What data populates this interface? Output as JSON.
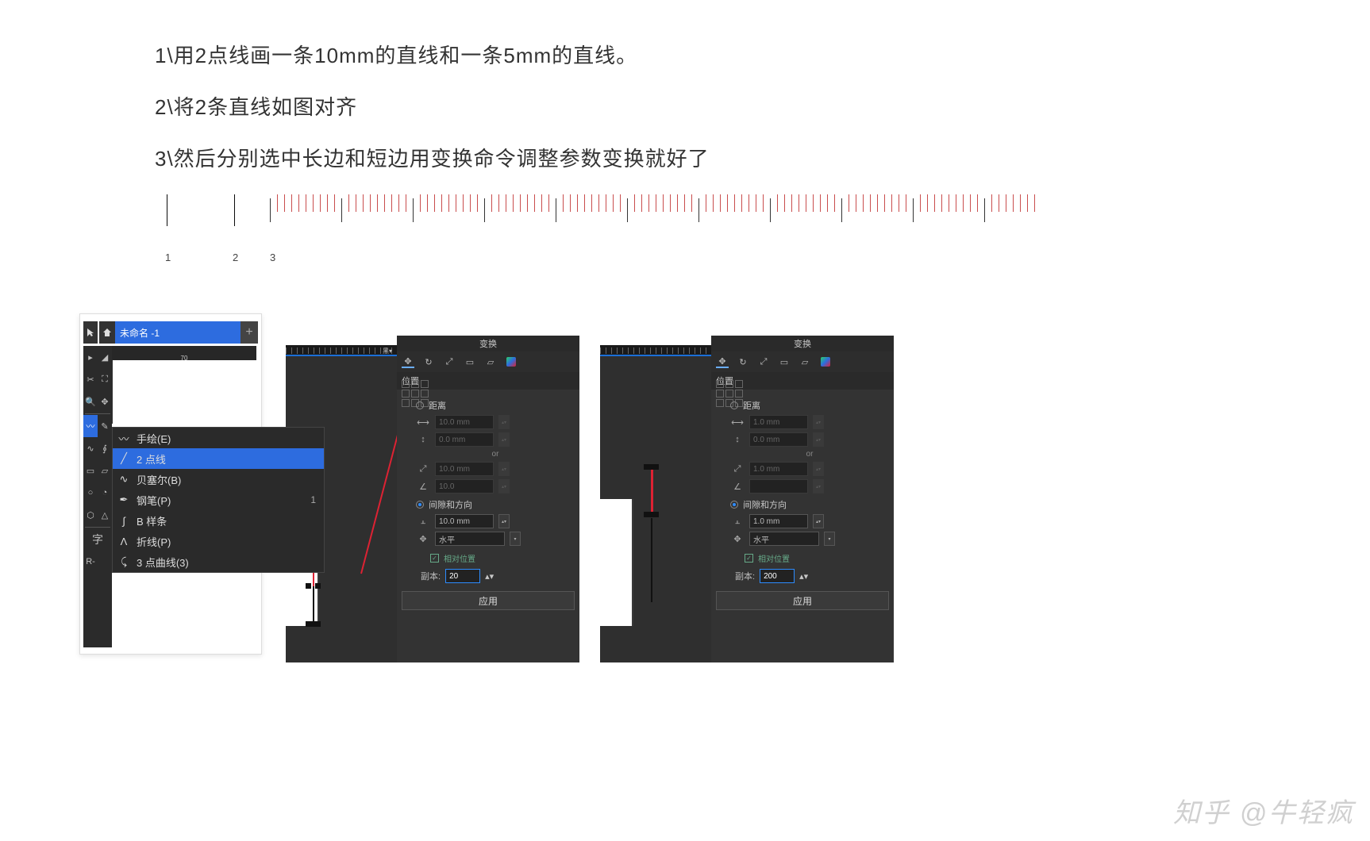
{
  "instructions": {
    "step1": "1\\用2点线画一条10mm的直线和一条5mm的直线。",
    "step2": "2\\将2条直线如图对齐",
    "step3": "3\\然后分别选中长边和短边用变换命令调整参数变换就好了"
  },
  "ruler_numbers": {
    "n1": "1",
    "n2": "2",
    "n3": "3"
  },
  "panel1": {
    "doc_tab": "未命名 -1",
    "add_tab": "+",
    "ruler_mark": "70",
    "text_tool": "字",
    "flyout": {
      "freehand": "手绘(E)",
      "two_point": "2 点线",
      "bezier": "贝塞尔(B)",
      "pen": "钢笔(P)",
      "pen_shortcut": "1",
      "bspline": "B 样条",
      "polyline": "折线(P)",
      "three_point": "3 点曲线(3)"
    }
  },
  "docker_common": {
    "title": "变换",
    "subtitle": "位置",
    "group_distance": "距离",
    "or_label": "or",
    "group_gap": "间隙和方向",
    "direction_value": "水平",
    "use_relative": "相对位置",
    "copies_label": "副本:",
    "apply": "应用"
  },
  "panel2": {
    "dist_h": "10.0 mm",
    "dist_v": "0.0 mm",
    "angle_len": "10.0 mm",
    "angle_deg": "10.0",
    "gap_value": "10.0 mm",
    "copies_value": "20"
  },
  "panel3": {
    "dist_h": "1.0 mm",
    "dist_v": "0.0 mm",
    "angle_len": "1.0 mm",
    "angle_deg": "",
    "gap_value": "1.0 mm",
    "copies_value": "200"
  },
  "watermark": "知乎 @牛轻疯"
}
